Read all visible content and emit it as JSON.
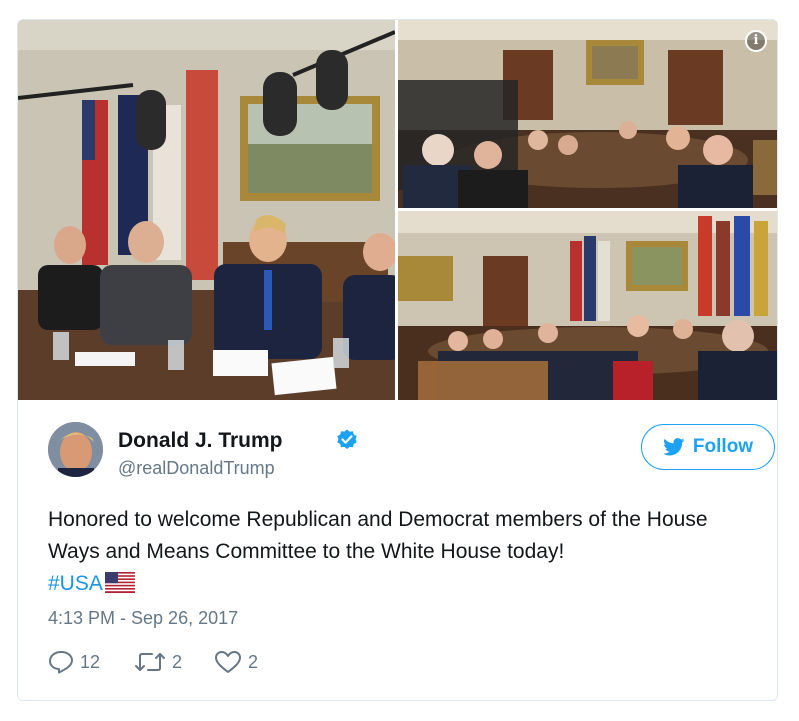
{
  "media": {
    "info_icon": "info-icon"
  },
  "user": {
    "display_name": "Donald J. Trump",
    "handle": "@realDonaldTrump",
    "verified_icon": "verified-badge-icon"
  },
  "follow_button": {
    "label": "Follow",
    "icon": "twitter-bird-icon"
  },
  "tweet": {
    "text_line": "Honored to welcome Republican and Democrat members of the House Ways and Means Committee to the White House today!",
    "hashtag": "#USA",
    "flag_icon": "us-flag-icon",
    "timestamp": "4:13 PM - Sep 26, 2017"
  },
  "actions": {
    "reply_count": "12",
    "retweet_count": "2",
    "like_count": "2"
  },
  "colors": {
    "accent": "#1da1f2",
    "hashtag": "#1b95e0",
    "muted": "#657786",
    "text": "#14171a"
  }
}
